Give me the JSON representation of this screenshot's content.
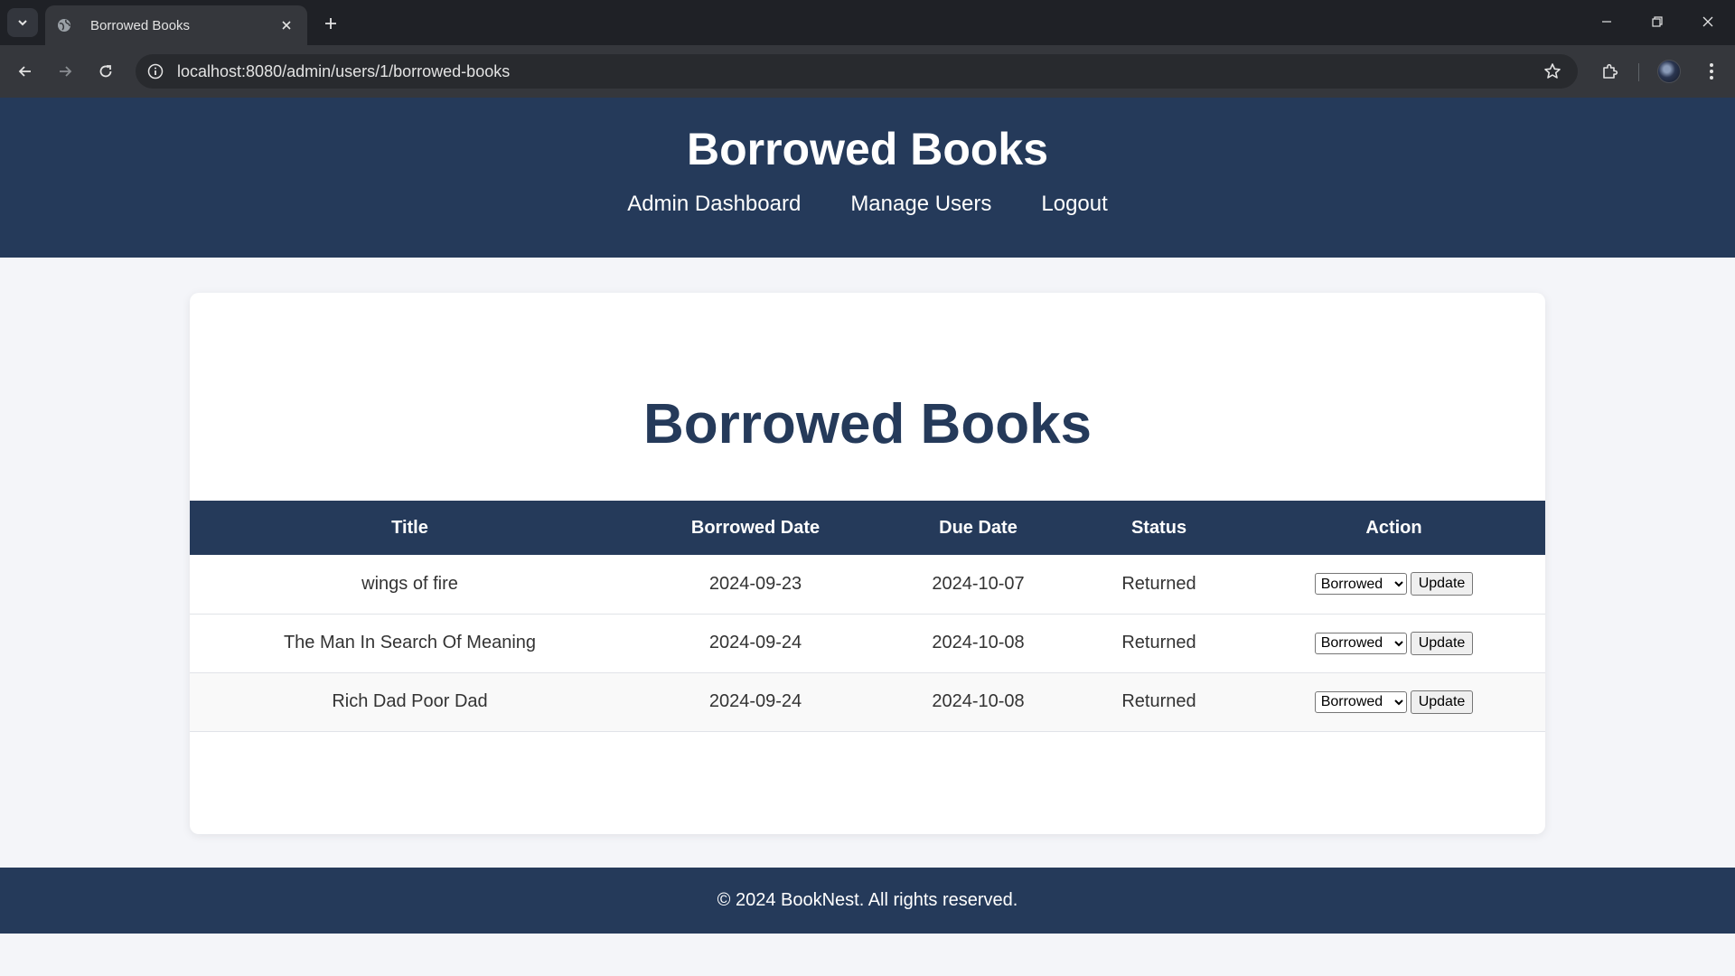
{
  "browser": {
    "tab_title": "Borrowed Books",
    "url": "localhost:8080/admin/users/1/borrowed-books"
  },
  "header": {
    "title": "Borrowed Books",
    "nav": [
      "Admin Dashboard",
      "Manage Users",
      "Logout"
    ]
  },
  "main": {
    "heading": "Borrowed Books",
    "columns": [
      "Title",
      "Borrowed Date",
      "Due Date",
      "Status",
      "Action"
    ],
    "rows": [
      {
        "title": "wings of fire",
        "borrowed_date": "2024-09-23",
        "due_date": "2024-10-07",
        "status": "Returned",
        "select_value": "Borrowed",
        "button": "Update"
      },
      {
        "title": "The Man In Search Of Meaning",
        "borrowed_date": "2024-09-24",
        "due_date": "2024-10-08",
        "status": "Returned",
        "select_value": "Borrowed",
        "button": "Update"
      },
      {
        "title": "Rich Dad Poor Dad",
        "borrowed_date": "2024-09-24",
        "due_date": "2024-10-08",
        "status": "Returned",
        "select_value": "Borrowed",
        "button": "Update"
      }
    ]
  },
  "footer": {
    "text": "© 2024 BookNest. All rights reserved."
  },
  "colors": {
    "brand": "#253a5a",
    "page_bg": "#f4f5f9"
  }
}
